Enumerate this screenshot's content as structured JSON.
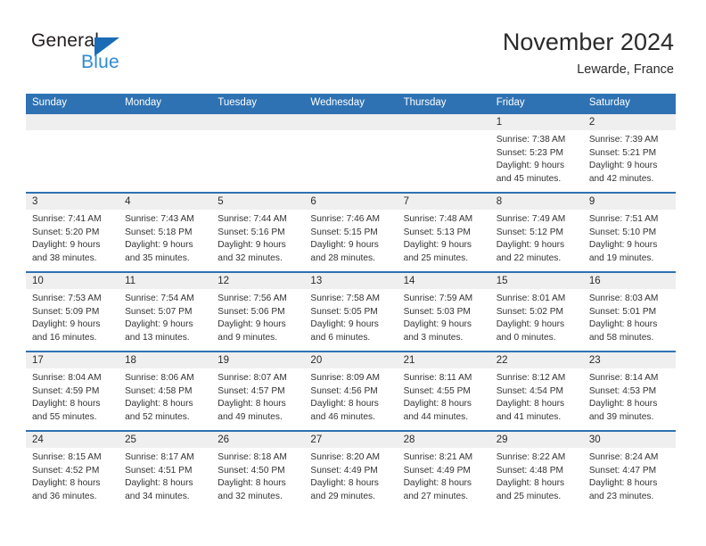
{
  "brand": {
    "name_part1": "General",
    "name_part2": "Blue",
    "triangle_color": "#1b6cb5",
    "blue_text_color": "#2e8bd4"
  },
  "header": {
    "title": "November 2024",
    "location": "Lewarde, France"
  },
  "theme": {
    "header_blue": "#2e72b3",
    "day_band_gray": "#efefef",
    "text_color": "#2b2b2b"
  },
  "calendar": {
    "weekday_headers": [
      "Sunday",
      "Monday",
      "Tuesday",
      "Wednesday",
      "Thursday",
      "Friday",
      "Saturday"
    ],
    "weeks": [
      [
        {
          "day": "",
          "sunrise": "",
          "sunset": "",
          "daylight_line1": "",
          "daylight_line2": ""
        },
        {
          "day": "",
          "sunrise": "",
          "sunset": "",
          "daylight_line1": "",
          "daylight_line2": ""
        },
        {
          "day": "",
          "sunrise": "",
          "sunset": "",
          "daylight_line1": "",
          "daylight_line2": ""
        },
        {
          "day": "",
          "sunrise": "",
          "sunset": "",
          "daylight_line1": "",
          "daylight_line2": ""
        },
        {
          "day": "",
          "sunrise": "",
          "sunset": "",
          "daylight_line1": "",
          "daylight_line2": ""
        },
        {
          "day": "1",
          "sunrise": "Sunrise: 7:38 AM",
          "sunset": "Sunset: 5:23 PM",
          "daylight_line1": "Daylight: 9 hours",
          "daylight_line2": "and 45 minutes."
        },
        {
          "day": "2",
          "sunrise": "Sunrise: 7:39 AM",
          "sunset": "Sunset: 5:21 PM",
          "daylight_line1": "Daylight: 9 hours",
          "daylight_line2": "and 42 minutes."
        }
      ],
      [
        {
          "day": "3",
          "sunrise": "Sunrise: 7:41 AM",
          "sunset": "Sunset: 5:20 PM",
          "daylight_line1": "Daylight: 9 hours",
          "daylight_line2": "and 38 minutes."
        },
        {
          "day": "4",
          "sunrise": "Sunrise: 7:43 AM",
          "sunset": "Sunset: 5:18 PM",
          "daylight_line1": "Daylight: 9 hours",
          "daylight_line2": "and 35 minutes."
        },
        {
          "day": "5",
          "sunrise": "Sunrise: 7:44 AM",
          "sunset": "Sunset: 5:16 PM",
          "daylight_line1": "Daylight: 9 hours",
          "daylight_line2": "and 32 minutes."
        },
        {
          "day": "6",
          "sunrise": "Sunrise: 7:46 AM",
          "sunset": "Sunset: 5:15 PM",
          "daylight_line1": "Daylight: 9 hours",
          "daylight_line2": "and 28 minutes."
        },
        {
          "day": "7",
          "sunrise": "Sunrise: 7:48 AM",
          "sunset": "Sunset: 5:13 PM",
          "daylight_line1": "Daylight: 9 hours",
          "daylight_line2": "and 25 minutes."
        },
        {
          "day": "8",
          "sunrise": "Sunrise: 7:49 AM",
          "sunset": "Sunset: 5:12 PM",
          "daylight_line1": "Daylight: 9 hours",
          "daylight_line2": "and 22 minutes."
        },
        {
          "day": "9",
          "sunrise": "Sunrise: 7:51 AM",
          "sunset": "Sunset: 5:10 PM",
          "daylight_line1": "Daylight: 9 hours",
          "daylight_line2": "and 19 minutes."
        }
      ],
      [
        {
          "day": "10",
          "sunrise": "Sunrise: 7:53 AM",
          "sunset": "Sunset: 5:09 PM",
          "daylight_line1": "Daylight: 9 hours",
          "daylight_line2": "and 16 minutes."
        },
        {
          "day": "11",
          "sunrise": "Sunrise: 7:54 AM",
          "sunset": "Sunset: 5:07 PM",
          "daylight_line1": "Daylight: 9 hours",
          "daylight_line2": "and 13 minutes."
        },
        {
          "day": "12",
          "sunrise": "Sunrise: 7:56 AM",
          "sunset": "Sunset: 5:06 PM",
          "daylight_line1": "Daylight: 9 hours",
          "daylight_line2": "and 9 minutes."
        },
        {
          "day": "13",
          "sunrise": "Sunrise: 7:58 AM",
          "sunset": "Sunset: 5:05 PM",
          "daylight_line1": "Daylight: 9 hours",
          "daylight_line2": "and 6 minutes."
        },
        {
          "day": "14",
          "sunrise": "Sunrise: 7:59 AM",
          "sunset": "Sunset: 5:03 PM",
          "daylight_line1": "Daylight: 9 hours",
          "daylight_line2": "and 3 minutes."
        },
        {
          "day": "15",
          "sunrise": "Sunrise: 8:01 AM",
          "sunset": "Sunset: 5:02 PM",
          "daylight_line1": "Daylight: 9 hours",
          "daylight_line2": "and 0 minutes."
        },
        {
          "day": "16",
          "sunrise": "Sunrise: 8:03 AM",
          "sunset": "Sunset: 5:01 PM",
          "daylight_line1": "Daylight: 8 hours",
          "daylight_line2": "and 58 minutes."
        }
      ],
      [
        {
          "day": "17",
          "sunrise": "Sunrise: 8:04 AM",
          "sunset": "Sunset: 4:59 PM",
          "daylight_line1": "Daylight: 8 hours",
          "daylight_line2": "and 55 minutes."
        },
        {
          "day": "18",
          "sunrise": "Sunrise: 8:06 AM",
          "sunset": "Sunset: 4:58 PM",
          "daylight_line1": "Daylight: 8 hours",
          "daylight_line2": "and 52 minutes."
        },
        {
          "day": "19",
          "sunrise": "Sunrise: 8:07 AM",
          "sunset": "Sunset: 4:57 PM",
          "daylight_line1": "Daylight: 8 hours",
          "daylight_line2": "and 49 minutes."
        },
        {
          "day": "20",
          "sunrise": "Sunrise: 8:09 AM",
          "sunset": "Sunset: 4:56 PM",
          "daylight_line1": "Daylight: 8 hours",
          "daylight_line2": "and 46 minutes."
        },
        {
          "day": "21",
          "sunrise": "Sunrise: 8:11 AM",
          "sunset": "Sunset: 4:55 PM",
          "daylight_line1": "Daylight: 8 hours",
          "daylight_line2": "and 44 minutes."
        },
        {
          "day": "22",
          "sunrise": "Sunrise: 8:12 AM",
          "sunset": "Sunset: 4:54 PM",
          "daylight_line1": "Daylight: 8 hours",
          "daylight_line2": "and 41 minutes."
        },
        {
          "day": "23",
          "sunrise": "Sunrise: 8:14 AM",
          "sunset": "Sunset: 4:53 PM",
          "daylight_line1": "Daylight: 8 hours",
          "daylight_line2": "and 39 minutes."
        }
      ],
      [
        {
          "day": "24",
          "sunrise": "Sunrise: 8:15 AM",
          "sunset": "Sunset: 4:52 PM",
          "daylight_line1": "Daylight: 8 hours",
          "daylight_line2": "and 36 minutes."
        },
        {
          "day": "25",
          "sunrise": "Sunrise: 8:17 AM",
          "sunset": "Sunset: 4:51 PM",
          "daylight_line1": "Daylight: 8 hours",
          "daylight_line2": "and 34 minutes."
        },
        {
          "day": "26",
          "sunrise": "Sunrise: 8:18 AM",
          "sunset": "Sunset: 4:50 PM",
          "daylight_line1": "Daylight: 8 hours",
          "daylight_line2": "and 32 minutes."
        },
        {
          "day": "27",
          "sunrise": "Sunrise: 8:20 AM",
          "sunset": "Sunset: 4:49 PM",
          "daylight_line1": "Daylight: 8 hours",
          "daylight_line2": "and 29 minutes."
        },
        {
          "day": "28",
          "sunrise": "Sunrise: 8:21 AM",
          "sunset": "Sunset: 4:49 PM",
          "daylight_line1": "Daylight: 8 hours",
          "daylight_line2": "and 27 minutes."
        },
        {
          "day": "29",
          "sunrise": "Sunrise: 8:22 AM",
          "sunset": "Sunset: 4:48 PM",
          "daylight_line1": "Daylight: 8 hours",
          "daylight_line2": "and 25 minutes."
        },
        {
          "day": "30",
          "sunrise": "Sunrise: 8:24 AM",
          "sunset": "Sunset: 4:47 PM",
          "daylight_line1": "Daylight: 8 hours",
          "daylight_line2": "and 23 minutes."
        }
      ]
    ]
  }
}
